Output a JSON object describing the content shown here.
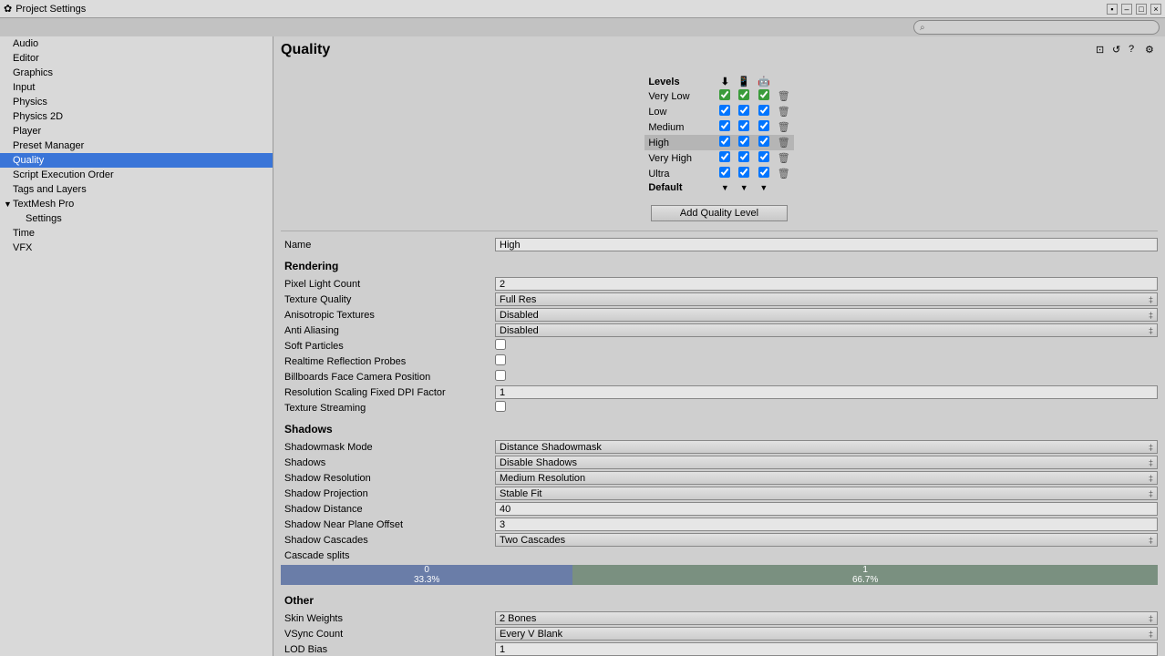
{
  "window": {
    "title": "Project Settings"
  },
  "search": {
    "placeholder": "⌕"
  },
  "sidebar": {
    "items": [
      {
        "label": "Audio"
      },
      {
        "label": "Editor"
      },
      {
        "label": "Graphics"
      },
      {
        "label": "Input"
      },
      {
        "label": "Physics"
      },
      {
        "label": "Physics 2D"
      },
      {
        "label": "Player"
      },
      {
        "label": "Preset Manager"
      },
      {
        "label": "Quality",
        "selected": true
      },
      {
        "label": "Script Execution Order"
      },
      {
        "label": "Tags and Layers"
      },
      {
        "label": "TextMesh Pro",
        "expanded": true
      },
      {
        "label": "Settings",
        "child": true
      },
      {
        "label": "Time"
      },
      {
        "label": "VFX"
      }
    ]
  },
  "page_title": "Quality",
  "levels": {
    "header": "Levels",
    "platforms": [
      "⬇",
      "📱",
      "🤖"
    ],
    "rows": [
      {
        "name": "Very Low",
        "checks": [
          true,
          true,
          true
        ],
        "green": true
      },
      {
        "name": "Low",
        "checks": [
          true,
          true,
          true
        ]
      },
      {
        "name": "Medium",
        "checks": [
          true,
          true,
          true
        ]
      },
      {
        "name": "High",
        "checks": [
          true,
          true,
          true
        ],
        "selected": true
      },
      {
        "name": "Very High",
        "checks": [
          true,
          true,
          true
        ]
      },
      {
        "name": "Ultra",
        "checks": [
          true,
          true,
          true
        ]
      }
    ],
    "default_label": "Default",
    "add_button": "Add Quality Level"
  },
  "fields": {
    "name_label": "Name",
    "name_value": "High",
    "rendering_h": "Rendering",
    "pixel_light_label": "Pixel Light Count",
    "pixel_light_value": "2",
    "tex_quality_label": "Texture Quality",
    "tex_quality_value": "Full Res",
    "aniso_label": "Anisotropic Textures",
    "aniso_value": "Disabled",
    "aa_label": "Anti Aliasing",
    "aa_value": "Disabled",
    "soft_particles_label": "Soft Particles",
    "reflection_label": "Realtime Reflection Probes",
    "billboards_label": "Billboards Face Camera Position",
    "resscale_label": "Resolution Scaling Fixed DPI Factor",
    "resscale_value": "1",
    "texstream_label": "Texture Streaming",
    "shadows_h": "Shadows",
    "smask_label": "Shadowmask Mode",
    "smask_value": "Distance Shadowmask",
    "shadows_label": "Shadows",
    "shadows_value": "Disable Shadows",
    "sres_label": "Shadow Resolution",
    "sres_value": "Medium Resolution",
    "sproj_label": "Shadow Projection",
    "sproj_value": "Stable Fit",
    "sdist_label": "Shadow Distance",
    "sdist_value": "40",
    "snear_label": "Shadow Near Plane Offset",
    "snear_value": "3",
    "scasc_label": "Shadow Cascades",
    "scasc_value": "Two Cascades",
    "csplits_label": "Cascade splits",
    "cascade0_idx": "0",
    "cascade0_pct": "33.3%",
    "cascade1_idx": "1",
    "cascade1_pct": "66.7%",
    "other_h": "Other",
    "skinw_label": "Skin Weights",
    "skinw_value": "2 Bones",
    "vsync_label": "VSync Count",
    "vsync_value": "Every V Blank",
    "lod_label": "LOD Bias",
    "lod_value": "1"
  }
}
